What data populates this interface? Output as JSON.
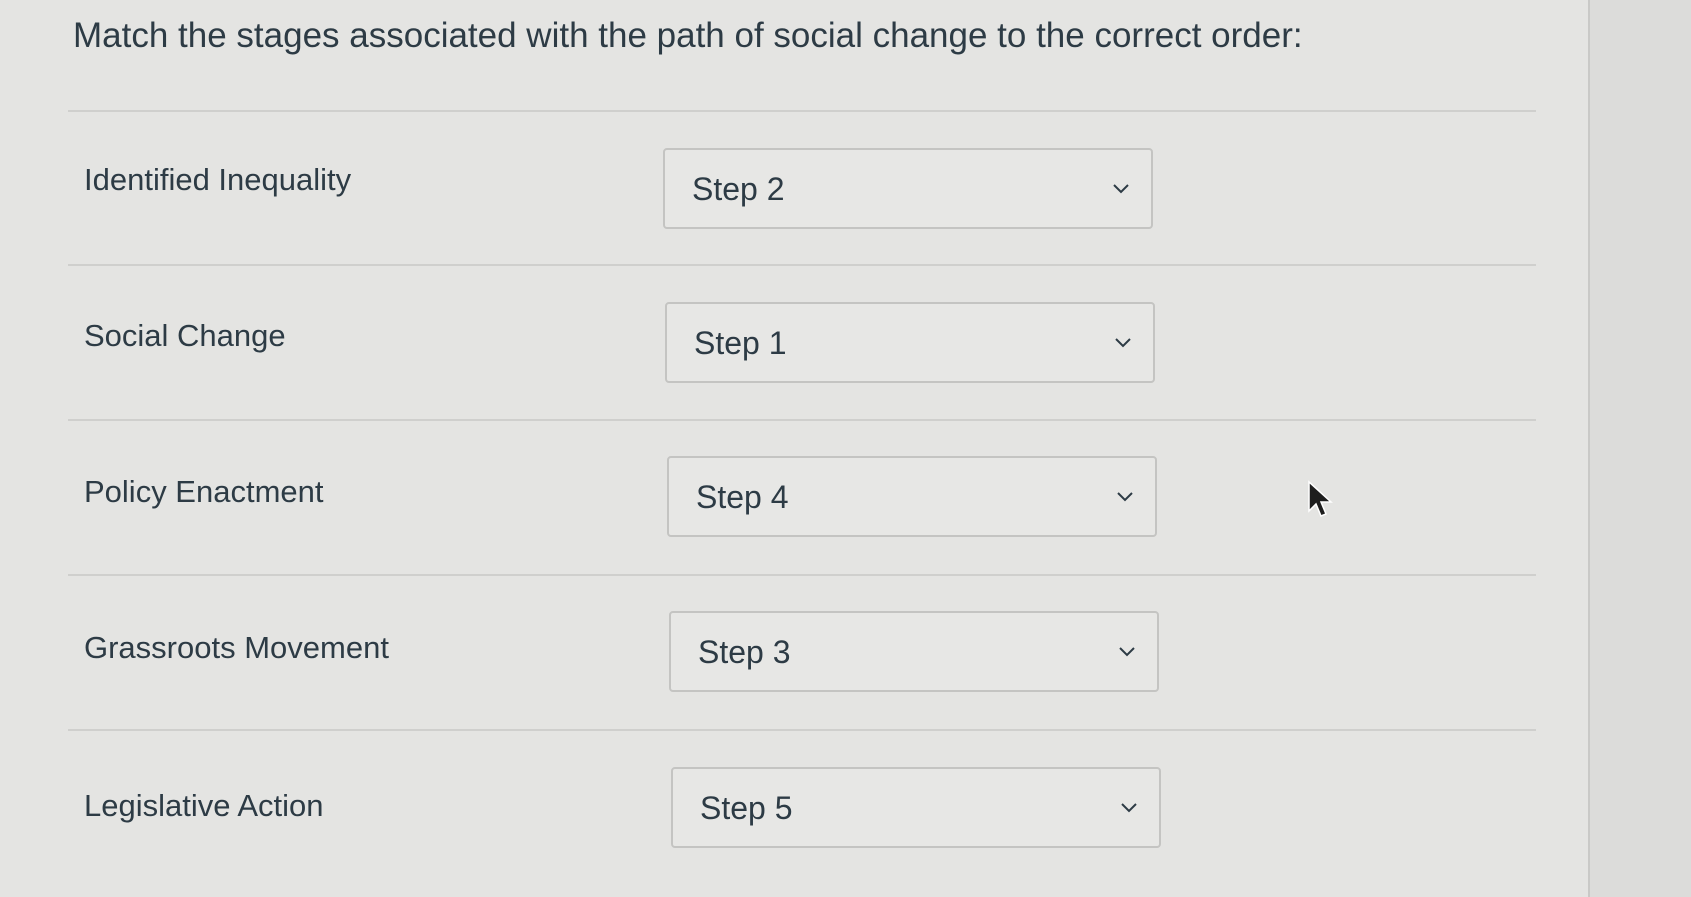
{
  "question": {
    "prompt": "Match the stages associated with the path of social change to the correct order:"
  },
  "rows": [
    {
      "label": "Identified Inequality",
      "selected": "Step 2"
    },
    {
      "label": "Social Change",
      "selected": "Step 1"
    },
    {
      "label": "Policy Enactment",
      "selected": "Step 4"
    },
    {
      "label": "Grassroots Movement",
      "selected": "Step 3"
    },
    {
      "label": "Legislative Action",
      "selected": "Step 5"
    }
  ],
  "icons": {
    "dropdown": "chevron-down-icon",
    "pointer": "mouse-cursor-icon"
  },
  "colors": {
    "text": "#2d3b45",
    "background": "#e4e4e2",
    "border": "#c4c4c2"
  }
}
